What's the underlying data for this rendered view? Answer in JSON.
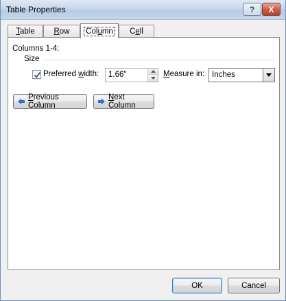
{
  "window": {
    "title": "Table Properties",
    "help_glyph": "?",
    "close_glyph": "X"
  },
  "tabs": [
    {
      "label_pre": "",
      "label_key": "T",
      "label_post": "able",
      "active": false
    },
    {
      "label_pre": "",
      "label_key": "R",
      "label_post": "ow",
      "active": false
    },
    {
      "label_pre": "Col",
      "label_key": "u",
      "label_post": "mn",
      "active": true
    },
    {
      "label_pre": "C",
      "label_key": "e",
      "label_post": "ll",
      "active": false
    }
  ],
  "column": {
    "columns_label": "Columns 1-4:",
    "size_label": "Size",
    "preferred_width": {
      "checked": true,
      "label_pre": "Preferred ",
      "label_key": "w",
      "label_post": "idth:",
      "value": "1.66\""
    },
    "measure_in": {
      "label_key": "M",
      "label_post": "easure in:",
      "value": "Inches"
    },
    "previous_button": {
      "label_key": "P",
      "label_post": "revious Column"
    },
    "next_button": {
      "label_key": "N",
      "label_post": "ext Column"
    }
  },
  "footer": {
    "ok_label": "OK",
    "cancel_label": "Cancel"
  },
  "colors": {
    "arrow_blue": "#2f6fd1",
    "check_blue": "#2b4f8f"
  }
}
